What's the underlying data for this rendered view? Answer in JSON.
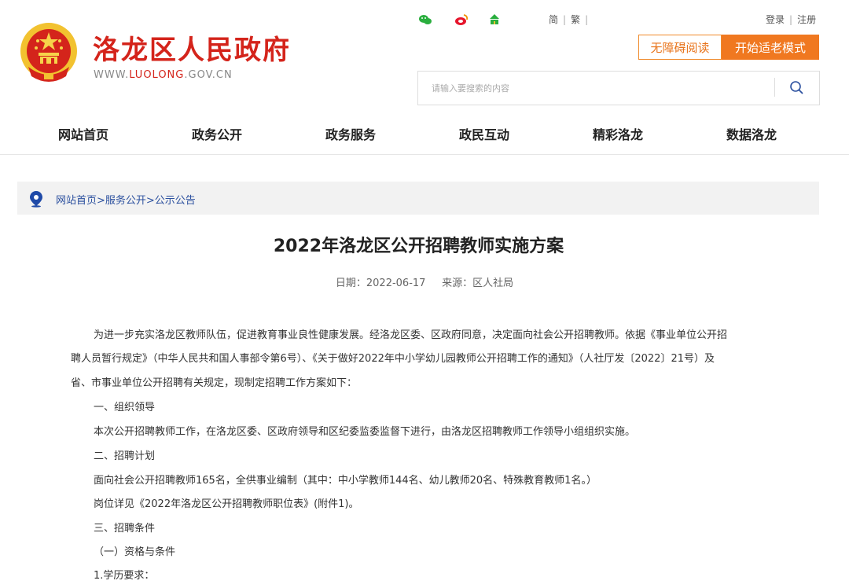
{
  "header": {
    "site_title": "洛龙区人民政府",
    "site_url_prefix": "WWW.",
    "site_url_highlight": "LUOLONG",
    "site_url_suffix": ".GOV.CN",
    "lang_simplified": "简",
    "lang_traditional": "繁",
    "login": "登录",
    "register": "注册",
    "accessible_reading": "无障碍阅读",
    "elderly_mode": "开始适老模式",
    "search_placeholder": "请输入要搜索的内容"
  },
  "nav": [
    "网站首页",
    "政务公开",
    "政务服务",
    "政民互动",
    "精彩洛龙",
    "数据洛龙"
  ],
  "breadcrumb": "网站首页>服务公开>公示公告",
  "article": {
    "title": "2022年洛龙区公开招聘教师实施方案",
    "date_label": "日期：2022-06-17",
    "source_label": "来源：区人社局",
    "paragraphs": [
      "为进一步充实洛龙区教师队伍，促进教育事业良性健康发展。经洛龙区委、区政府同意，决定面向社会公开招聘教师。依据《事业单位公开招",
      "聘人员暂行规定》（中华人民共和国人事部令第6号）、《关于做好2022年中小学幼儿园教师公开招聘工作的通知》（人社厅发〔2022〕21号）及",
      "省、市事业单位公开招聘有关规定，现制定招聘工作方案如下：",
      "一、组织领导",
      "本次公开招聘教师工作，在洛龙区委、区政府领导和区纪委监委监督下进行，由洛龙区招聘教师工作领导小组组织实施。",
      "二、招聘计划",
      "面向社会公开招聘教师165名，全供事业编制（其中：中小学教师144名、幼儿教师20名、特殊教育教师1名。）",
      "岗位详见《2022年洛龙区公开招聘教师职位表》(附件1)。",
      "三、招聘条件",
      "（一）资格与条件",
      "1.学历要求："
    ]
  },
  "colors": {
    "brand_red": "#d4241b",
    "orange": "#f07820",
    "link_blue": "#2a4f9e"
  },
  "icons": [
    "national-emblem-icon",
    "wechat-icon",
    "weibo-icon",
    "app-icon",
    "search-icon",
    "location-pin-icon"
  ]
}
